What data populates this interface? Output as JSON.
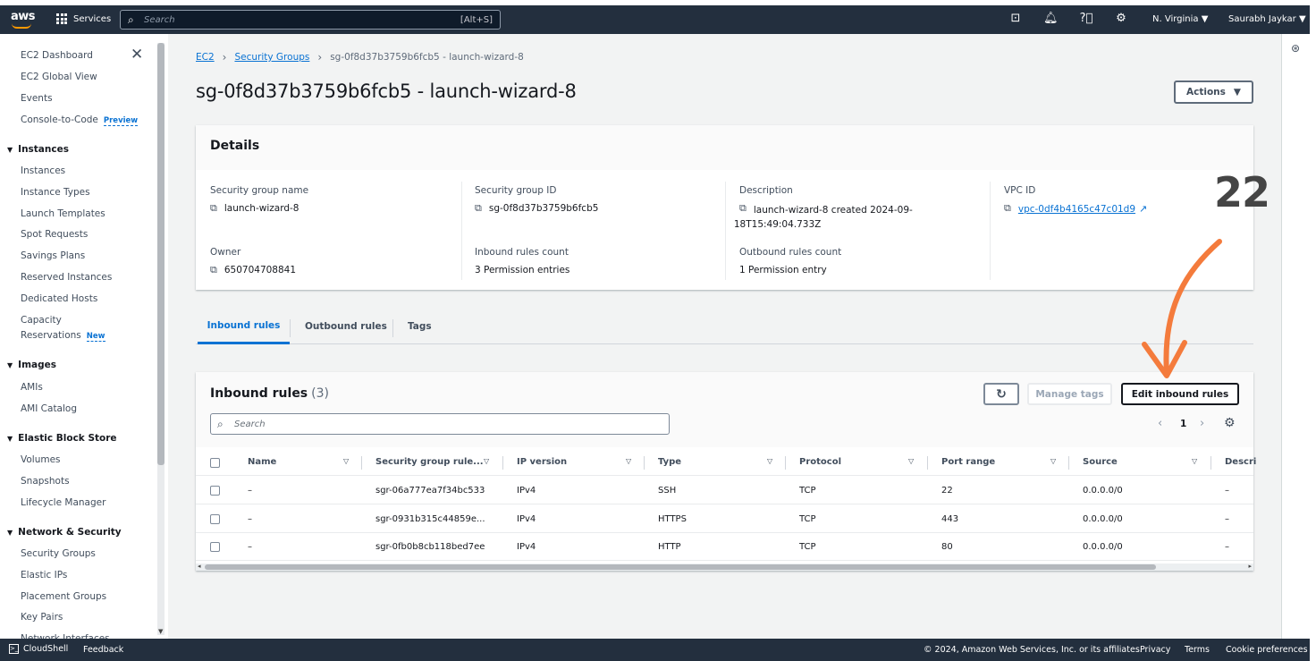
{
  "topbar": {
    "logo": "aws",
    "services_label": "Services",
    "search_placeholder": "Search",
    "search_shortcut": "[Alt+S]",
    "region": "N. Virginia ▼",
    "user": "Saurabh Jaykar ▼"
  },
  "sidebar": {
    "items": [
      {
        "label": "EC2 Dashboard"
      },
      {
        "label": "EC2 Global View"
      },
      {
        "label": "Events"
      },
      {
        "label": "Console-to-Code",
        "badge": "Preview"
      }
    ],
    "sections": [
      {
        "title": "Instances",
        "items": [
          "Instances",
          "Instance Types",
          "Launch Templates",
          "Spot Requests",
          "Savings Plans",
          "Reserved Instances",
          "Dedicated Hosts"
        ],
        "extra_line1": "Capacity",
        "extra_line2": "Reservations",
        "extra_badge": "New"
      },
      {
        "title": "Images",
        "items": [
          "AMIs",
          "AMI Catalog"
        ]
      },
      {
        "title": "Elastic Block Store",
        "items": [
          "Volumes",
          "Snapshots",
          "Lifecycle Manager"
        ]
      },
      {
        "title": "Network & Security",
        "items": [
          "Security Groups",
          "Elastic IPs",
          "Placement Groups",
          "Key Pairs",
          "Network Interfaces"
        ]
      }
    ]
  },
  "breadcrumb": {
    "ec2": "EC2",
    "sg": "Security Groups",
    "current": "sg-0f8d37b3759b6fcb5 - launch-wizard-8"
  },
  "page": {
    "title": "sg-0f8d37b3759b6fcb5 - launch-wizard-8",
    "actions_label": "Actions"
  },
  "details": {
    "title": "Details",
    "sg_name_label": "Security group name",
    "sg_name": "launch-wizard-8",
    "sg_id_label": "Security group ID",
    "sg_id": "sg-0f8d37b3759b6fcb5",
    "desc_label": "Description",
    "desc_line1": "launch-wizard-8 created 2024-09-",
    "desc_line2": "18T15:49:04.733Z",
    "vpc_label": "VPC ID",
    "vpc_id": "vpc-0df4b4165c47c01d9",
    "owner_label": "Owner",
    "owner": "650704708841",
    "inbound_count_label": "Inbound rules count",
    "inbound_count": "3 Permission entries",
    "outbound_count_label": "Outbound rules count",
    "outbound_count": "1 Permission entry"
  },
  "annotation": {
    "number": "22",
    "arrow_color": "#f47b3c"
  },
  "tabs": [
    "Inbound rules",
    "Outbound rules",
    "Tags"
  ],
  "inbound": {
    "title": "Inbound rules",
    "count": "(3)",
    "manage_tags": "Manage tags",
    "edit_rules": "Edit inbound rules",
    "search_placeholder": "Search",
    "page": "1",
    "columns": [
      "Name",
      "Security group rule...",
      "IP version",
      "Type",
      "Protocol",
      "Port range",
      "Source",
      "Descri"
    ],
    "rows": [
      {
        "name": "–",
        "rule_id": "sgr-06a777ea7f34bc533",
        "ip": "IPv4",
        "type": "SSH",
        "protocol": "TCP",
        "port": "22",
        "source": "0.0.0.0/0",
        "desc": "–"
      },
      {
        "name": "–",
        "rule_id": "sgr-0931b315c44859e...",
        "ip": "IPv4",
        "type": "HTTPS",
        "protocol": "TCP",
        "port": "443",
        "source": "0.0.0.0/0",
        "desc": "–"
      },
      {
        "name": "–",
        "rule_id": "sgr-0fb0b8cb118bed7ee",
        "ip": "IPv4",
        "type": "HTTP",
        "protocol": "TCP",
        "port": "80",
        "source": "0.0.0.0/0",
        "desc": "–"
      }
    ]
  },
  "footer": {
    "cloudshell": "CloudShell",
    "feedback": "Feedback",
    "copyright": "© 2024, Amazon Web Services, Inc. or its affiliates.",
    "privacy": "Privacy",
    "terms": "Terms",
    "cookies": "Cookie preferences"
  }
}
